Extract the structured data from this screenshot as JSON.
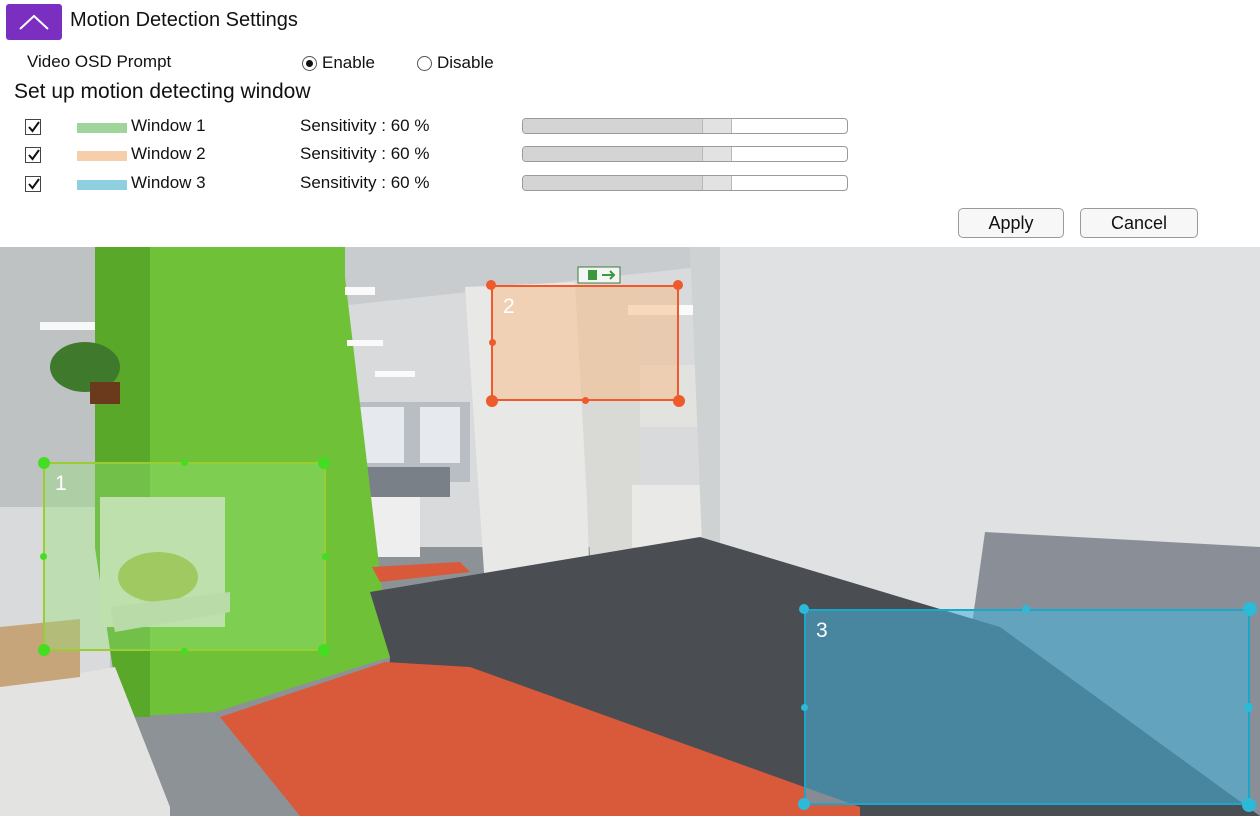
{
  "header": {
    "title": "Motion Detection Settings",
    "collapse_icon": "chevron-up-icon",
    "accent_color": "#7a2fc0"
  },
  "osd": {
    "label": "Video OSD Prompt",
    "options": [
      {
        "label": "Enable",
        "selected": true
      },
      {
        "label": "Disable",
        "selected": false
      }
    ]
  },
  "windows_section": {
    "title": "Set up motion detecting window",
    "windows": [
      {
        "label": "Window 1",
        "checked": true,
        "color": "#9fd49a",
        "sensitivity_text": "Sensitivity : 60 %",
        "sensitivity": 60
      },
      {
        "label": "Window 2",
        "checked": true,
        "color": "#f6cfaa",
        "sensitivity_text": "Sensitivity : 60 %",
        "sensitivity": 60
      },
      {
        "label": "Window 3",
        "checked": true,
        "color": "#8fd0e0",
        "sensitivity_text": "Sensitivity : 60 %",
        "sensitivity": 60
      }
    ]
  },
  "actions": {
    "apply_label": "Apply",
    "cancel_label": "Cancel"
  },
  "video": {
    "zones": [
      {
        "number": "1",
        "border_color": "#9acd32",
        "handle_color": "#44dd22"
      },
      {
        "number": "2",
        "border_color": "#ee5a2c",
        "handle_color": "#ee5a2c"
      },
      {
        "number": "3",
        "border_color": "#1aa7cc",
        "handle_color": "#2bbad8"
      }
    ],
    "exit_sign_icon": "exit-sign-icon"
  }
}
